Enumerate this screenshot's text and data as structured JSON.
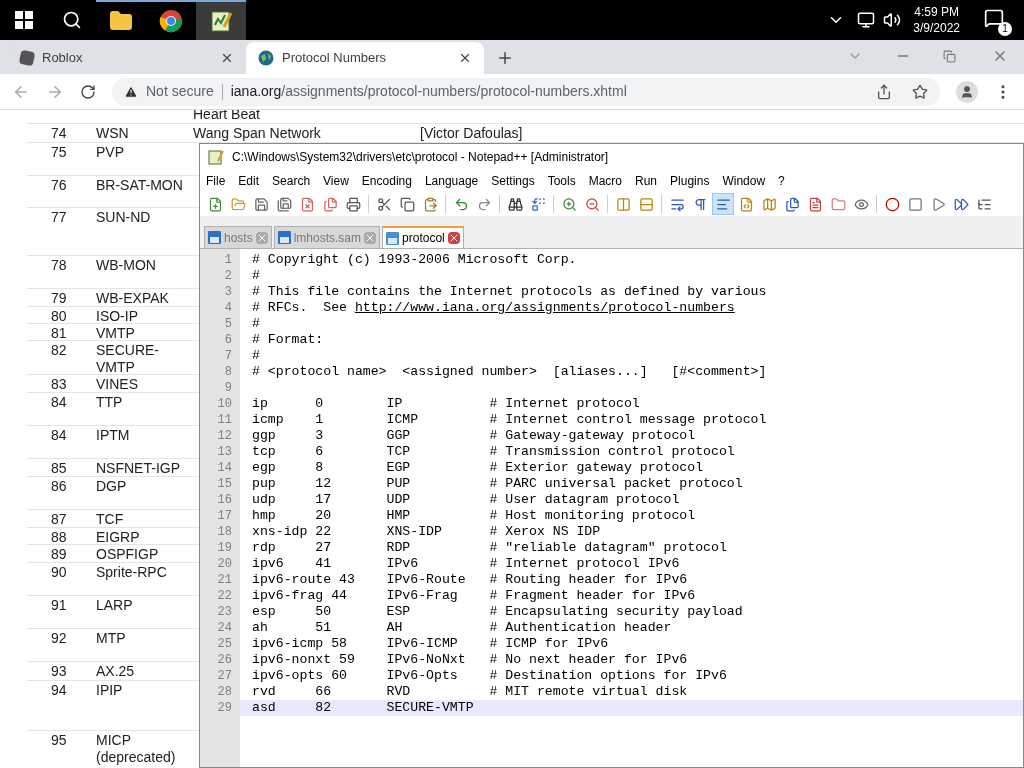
{
  "taskbar": {
    "apps": [
      {
        "kind": "explorer",
        "active": false
      },
      {
        "kind": "chrome",
        "active": false
      },
      {
        "kind": "notepad",
        "active": true
      }
    ],
    "time": "4:59 PM",
    "date": "3/9/2022",
    "notifications": "1"
  },
  "browser": {
    "tabs": [
      {
        "title": "Roblox",
        "selected": false
      },
      {
        "title": "Protocol Numbers",
        "selected": true
      }
    ],
    "security": "Not secure",
    "host": "iana.org",
    "path": "/assignments/protocol-numbers/protocol-numbers.xhtml"
  },
  "table": {
    "rows": [
      {
        "description": "Heart Beat"
      },
      {
        "number": "74",
        "name": "WSN",
        "description": "Wang Span Network",
        "reference": "[Victor Dafoulas]"
      },
      {
        "number": "75",
        "name": "PVP"
      },
      {
        "number": "76",
        "name": "BR-SAT-MON"
      },
      {
        "number": "77",
        "name": "SUN-ND"
      },
      {
        "number": "78",
        "name": "WB-MON"
      },
      {
        "number": "79",
        "name": "WB-EXPAK"
      },
      {
        "number": "80",
        "name": "ISO-IP"
      },
      {
        "number": "81",
        "name": "VMTP"
      },
      {
        "number": "82",
        "name": "SECURE-VMTP"
      },
      {
        "number": "83",
        "name": "VINES"
      },
      {
        "number": "84",
        "name": "TTP"
      },
      {
        "number": "84",
        "name": "IPTM"
      },
      {
        "number": "85",
        "name": "NSFNET-IGP"
      },
      {
        "number": "86",
        "name": "DGP"
      },
      {
        "number": "87",
        "name": "TCF"
      },
      {
        "number": "88",
        "name": "EIGRP"
      },
      {
        "number": "89",
        "name": "OSPFIGP"
      },
      {
        "number": "90",
        "name": "Sprite-RPC"
      },
      {
        "number": "91",
        "name": "LARP"
      },
      {
        "number": "92",
        "name": "MTP"
      },
      {
        "number": "93",
        "name": "AX.25"
      },
      {
        "number": "94",
        "name": "IPIP"
      },
      {
        "number": "95",
        "name": "MICP (deprecated)"
      }
    ]
  },
  "editor": {
    "title": "C:\\Windows\\System32\\drivers\\etc\\protocol - Notepad++ [Administrator]",
    "menu": [
      "File",
      "Edit",
      "Search",
      "View",
      "Encoding",
      "Language",
      "Settings",
      "Tools",
      "Macro",
      "Run",
      "Plugins",
      "Window",
      "?"
    ],
    "toolbar": [
      {
        "pressed": false
      },
      {
        "pressed": false
      },
      {
        "pressed": false
      },
      {
        "pressed": false
      },
      {
        "pressed": false
      },
      {
        "pressed": false
      },
      {
        "pressed": false
      },
      {
        "pressed": false
      },
      {
        "pressed": false
      },
      {
        "pressed": false
      },
      {
        "pressed": false
      },
      {
        "pressed": false
      },
      {
        "pressed": false
      },
      {
        "pressed": false
      },
      {
        "pressed": false
      },
      {
        "pressed": false
      },
      {
        "pressed": false
      },
      {
        "pressed": false
      },
      {
        "pressed": false
      },
      {
        "pressed": false
      },
      {
        "pressed": true
      },
      {
        "pressed": false
      },
      {
        "pressed": false
      },
      {
        "pressed": false
      },
      {
        "pressed": false
      },
      {
        "pressed": false
      },
      {
        "pressed": false
      },
      {
        "pressed": false
      },
      {
        "pressed": false
      },
      {
        "pressed": false
      },
      {
        "pressed": false
      },
      {
        "pressed": false
      }
    ],
    "tabs": [
      {
        "title": "hosts",
        "selected": false
      },
      {
        "title": "lmhosts.sam",
        "selected": false
      },
      {
        "title": "protocol",
        "selected": true
      }
    ],
    "lines": [
      {
        "number": "1",
        "kind": "text",
        "text": "# Copyright (c) 1993-2006 Microsoft Corp.",
        "current": false
      },
      {
        "number": "2",
        "kind": "text",
        "text": "#",
        "current": false
      },
      {
        "number": "3",
        "kind": "text",
        "text": "# This file contains the Internet protocols as defined by various",
        "current": false
      },
      {
        "number": "4",
        "kind": "text",
        "text": "# RFCs.  See ",
        "link": "http://www.iana.org/assignments/protocol-numbers",
        "current": false
      },
      {
        "number": "5",
        "kind": "text",
        "text": "#",
        "current": false
      },
      {
        "number": "6",
        "kind": "text",
        "text": "# Format:",
        "current": false
      },
      {
        "number": "7",
        "kind": "text",
        "text": "#",
        "current": false
      },
      {
        "number": "8",
        "kind": "text",
        "text": "# <protocol name>  <assigned number>  [aliases...]   [#<comment>]",
        "current": false
      },
      {
        "number": "9",
        "kind": "blank",
        "current": false
      },
      {
        "number": "10",
        "kind": "entry",
        "name": "ip",
        "value": "0",
        "alias": "IP",
        "comment": "# Internet protocol",
        "current": false
      },
      {
        "number": "11",
        "kind": "entry",
        "name": "icmp",
        "value": "1",
        "alias": "ICMP",
        "comment": "# Internet control message protocol",
        "current": false
      },
      {
        "number": "12",
        "kind": "entry",
        "name": "ggp",
        "value": "3",
        "alias": "GGP",
        "comment": "# Gateway-gateway protocol",
        "current": false
      },
      {
        "number": "13",
        "kind": "entry",
        "name": "tcp",
        "value": "6",
        "alias": "TCP",
        "comment": "# Transmission control protocol",
        "current": false
      },
      {
        "number": "14",
        "kind": "entry",
        "name": "egp",
        "value": "8",
        "alias": "EGP",
        "comment": "# Exterior gateway protocol",
        "current": false
      },
      {
        "number": "15",
        "kind": "entry",
        "name": "pup",
        "value": "12",
        "alias": "PUP",
        "comment": "# PARC universal packet protocol",
        "current": false
      },
      {
        "number": "16",
        "kind": "entry",
        "name": "udp",
        "value": "17",
        "alias": "UDP",
        "comment": "# User datagram protocol",
        "current": false
      },
      {
        "number": "17",
        "kind": "entry",
        "name": "hmp",
        "value": "20",
        "alias": "HMP",
        "comment": "# Host monitoring protocol",
        "current": false
      },
      {
        "number": "18",
        "kind": "entry",
        "name": "xns-idp",
        "value": "22",
        "alias": "XNS-IDP",
        "comment": "# Xerox NS IDP",
        "current": false
      },
      {
        "number": "19",
        "kind": "entry",
        "name": "rdp",
        "value": "27",
        "alias": "RDP",
        "comment": "# \"reliable datagram\" protocol",
        "current": false
      },
      {
        "number": "20",
        "kind": "entry",
        "name": "ipv6",
        "value": "41",
        "alias": "IPv6",
        "comment": "# Internet protocol IPv6",
        "current": false
      },
      {
        "number": "21",
        "kind": "entry",
        "name": "ipv6-route",
        "value": "43",
        "alias": "IPv6-Route",
        "comment": "# Routing header for IPv6",
        "current": false
      },
      {
        "number": "22",
        "kind": "entry",
        "name": "ipv6-frag",
        "value": "44",
        "alias": "IPv6-Frag",
        "comment": "# Fragment header for IPv6",
        "current": false
      },
      {
        "number": "23",
        "kind": "entry",
        "name": "esp",
        "value": "50",
        "alias": "ESP",
        "comment": "# Encapsulating security payload",
        "current": false
      },
      {
        "number": "24",
        "kind": "entry",
        "name": "ah",
        "value": "51",
        "alias": "AH",
        "comment": "# Authentication header",
        "current": false
      },
      {
        "number": "25",
        "kind": "entry",
        "name": "ipv6-icmp",
        "value": "58",
        "alias": "IPv6-ICMP",
        "comment": "# ICMP for IPv6",
        "current": false
      },
      {
        "number": "26",
        "kind": "entry",
        "name": "ipv6-nonxt",
        "value": "59",
        "alias": "IPv6-NoNxt",
        "comment": "# No next header for IPv6",
        "current": false
      },
      {
        "number": "27",
        "kind": "entry",
        "name": "ipv6-opts",
        "value": "60",
        "alias": "IPv6-Opts",
        "comment": "# Destination options for IPv6",
        "current": false
      },
      {
        "number": "28",
        "kind": "entry",
        "name": "rvd",
        "value": "66",
        "alias": "RVD",
        "comment": "# MIT remote virtual disk",
        "current": false
      },
      {
        "number": "29",
        "kind": "entry",
        "name": "asd",
        "value": "82",
        "alias": "SECURE-VMTP",
        "current": true
      }
    ]
  }
}
